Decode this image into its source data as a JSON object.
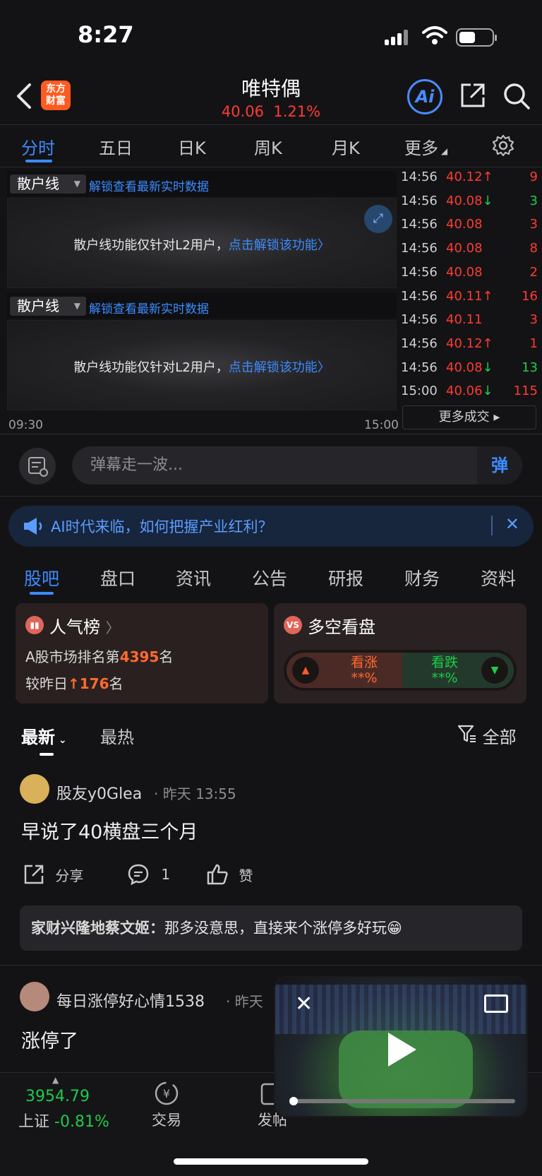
{
  "status": {
    "time": "8:27"
  },
  "header": {
    "logo_text": "东方\n财富",
    "stock_name": "唯特偶",
    "price": "40.06",
    "change": "1.21%",
    "ai_label": "Ai"
  },
  "chart_tabs": [
    "分时",
    "五日",
    "日K",
    "周K",
    "月K",
    "更多"
  ],
  "panels": [
    {
      "dropdown": "散户线",
      "link": "解锁查看最新实时数据",
      "msg": "散户线功能仅针对L2用户，",
      "msg_link": "点击解锁该功能"
    },
    {
      "dropdown": "散户线",
      "link": "解锁查看最新实时数据",
      "msg": "散户线功能仅针对L2用户，",
      "msg_link": "点击解锁该功能"
    }
  ],
  "time_axis": {
    "start": "09:30",
    "end": "15:00"
  },
  "trades": [
    {
      "time": "14:56",
      "price": "40.12",
      "arrow": "↑",
      "vol": "9",
      "dir": "red"
    },
    {
      "time": "14:56",
      "price": "40.08",
      "arrow": "↓",
      "vol": "3",
      "dir": "green"
    },
    {
      "time": "14:56",
      "price": "40.08",
      "arrow": "",
      "vol": "3",
      "dir": "red"
    },
    {
      "time": "14:56",
      "price": "40.08",
      "arrow": "",
      "vol": "8",
      "dir": "red"
    },
    {
      "time": "14:56",
      "price": "40.08",
      "arrow": "",
      "vol": "2",
      "dir": "red"
    },
    {
      "time": "14:56",
      "price": "40.11",
      "arrow": "↑",
      "vol": "16",
      "dir": "red"
    },
    {
      "time": "14:56",
      "price": "40.11",
      "arrow": "",
      "vol": "3",
      "dir": "red"
    },
    {
      "time": "14:56",
      "price": "40.12",
      "arrow": "↑",
      "vol": "1",
      "dir": "red"
    },
    {
      "time": "14:56",
      "price": "40.08",
      "arrow": "↓",
      "vol": "13",
      "dir": "green"
    },
    {
      "time": "15:00",
      "price": "40.06",
      "arrow": "↓",
      "vol": "115",
      "dir": "red"
    }
  ],
  "more_deals": "更多成交",
  "danmaku": {
    "placeholder": "弹幕走一波...",
    "button": "弹"
  },
  "banner": {
    "text": "AI时代来临，如何把握产业红利？"
  },
  "section_tabs": [
    "股吧",
    "盘口",
    "资讯",
    "公告",
    "研报",
    "财务",
    "资料"
  ],
  "popularity": {
    "title": "人气榜",
    "line1_prefix": "A股市场排名第",
    "rank": "4395",
    "line1_suffix": "名",
    "line2_prefix": "较昨日",
    "change": "176",
    "line2_suffix": "名"
  },
  "sentiment": {
    "title": "多空看盘",
    "up_label": "看涨",
    "up_value": "**%",
    "down_label": "看跌",
    "down_value": "**%"
  },
  "feed_tabs": {
    "latest": "最新",
    "hot": "最热",
    "filter": "全部"
  },
  "posts": [
    {
      "user": "股友y0Glea",
      "time": "昨天 13:55",
      "text": "早说了40横盘三个月",
      "share": "分享",
      "comments": "1",
      "like": "赞",
      "reply_user": "家财兴隆地蔡文姬：",
      "reply_text": "那多没意思，直接来个涨停多好玩😁"
    },
    {
      "user": "每日涨停好心情1538",
      "time": "昨天",
      "text": "涨停了"
    }
  ],
  "bottom_nav": {
    "index_value": "3954.79",
    "index_name": "上证",
    "index_change": "-0.81%",
    "trade": "交易",
    "post": "发帖"
  },
  "colors": {
    "up": "#ff3b30",
    "down": "#1fcb4a",
    "accent": "#3d8bff",
    "brand": "#ff5a1f"
  }
}
